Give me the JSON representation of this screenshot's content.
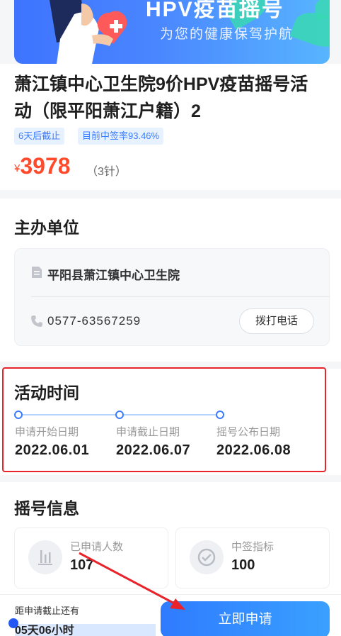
{
  "banner": {
    "title": "HPV疫苗摇号",
    "subtitle": "为您的健康保驾护航"
  },
  "event": {
    "title": "萧江镇中心卫生院9价HPV疫苗摇号活动（限平阳萧江户籍）2",
    "tags": [
      "6天后截止",
      "目前中签率93.46%"
    ],
    "currency": "¥",
    "price": "3978",
    "price_note": "（3针）"
  },
  "organizer": {
    "section_title": "主办单位",
    "name": "平阳县萧江镇中心卫生院",
    "phone": "0577-63567259",
    "call_label": "拨打电话"
  },
  "activity_time": {
    "section_title": "活动时间",
    "steps": [
      {
        "label": "申请开始日期",
        "date": "2022.06.01"
      },
      {
        "label": "申请截止日期",
        "date": "2022.06.07"
      },
      {
        "label": "摇号公布日期",
        "date": "2022.06.08"
      }
    ]
  },
  "lottery": {
    "section_title": "摇号信息",
    "stats": [
      {
        "label": "已申请人数",
        "value": "107"
      },
      {
        "label": "中签指标",
        "value": "100"
      }
    ]
  },
  "footer": {
    "deadline_label": "距申请截止还有",
    "deadline_value": "05天06小时",
    "apply_label": "立即申请"
  },
  "colors": {
    "accent": "#3b7cff",
    "price": "#ff4a2b",
    "highlight": "#e8232b",
    "leaf": "#38d8b3"
  }
}
